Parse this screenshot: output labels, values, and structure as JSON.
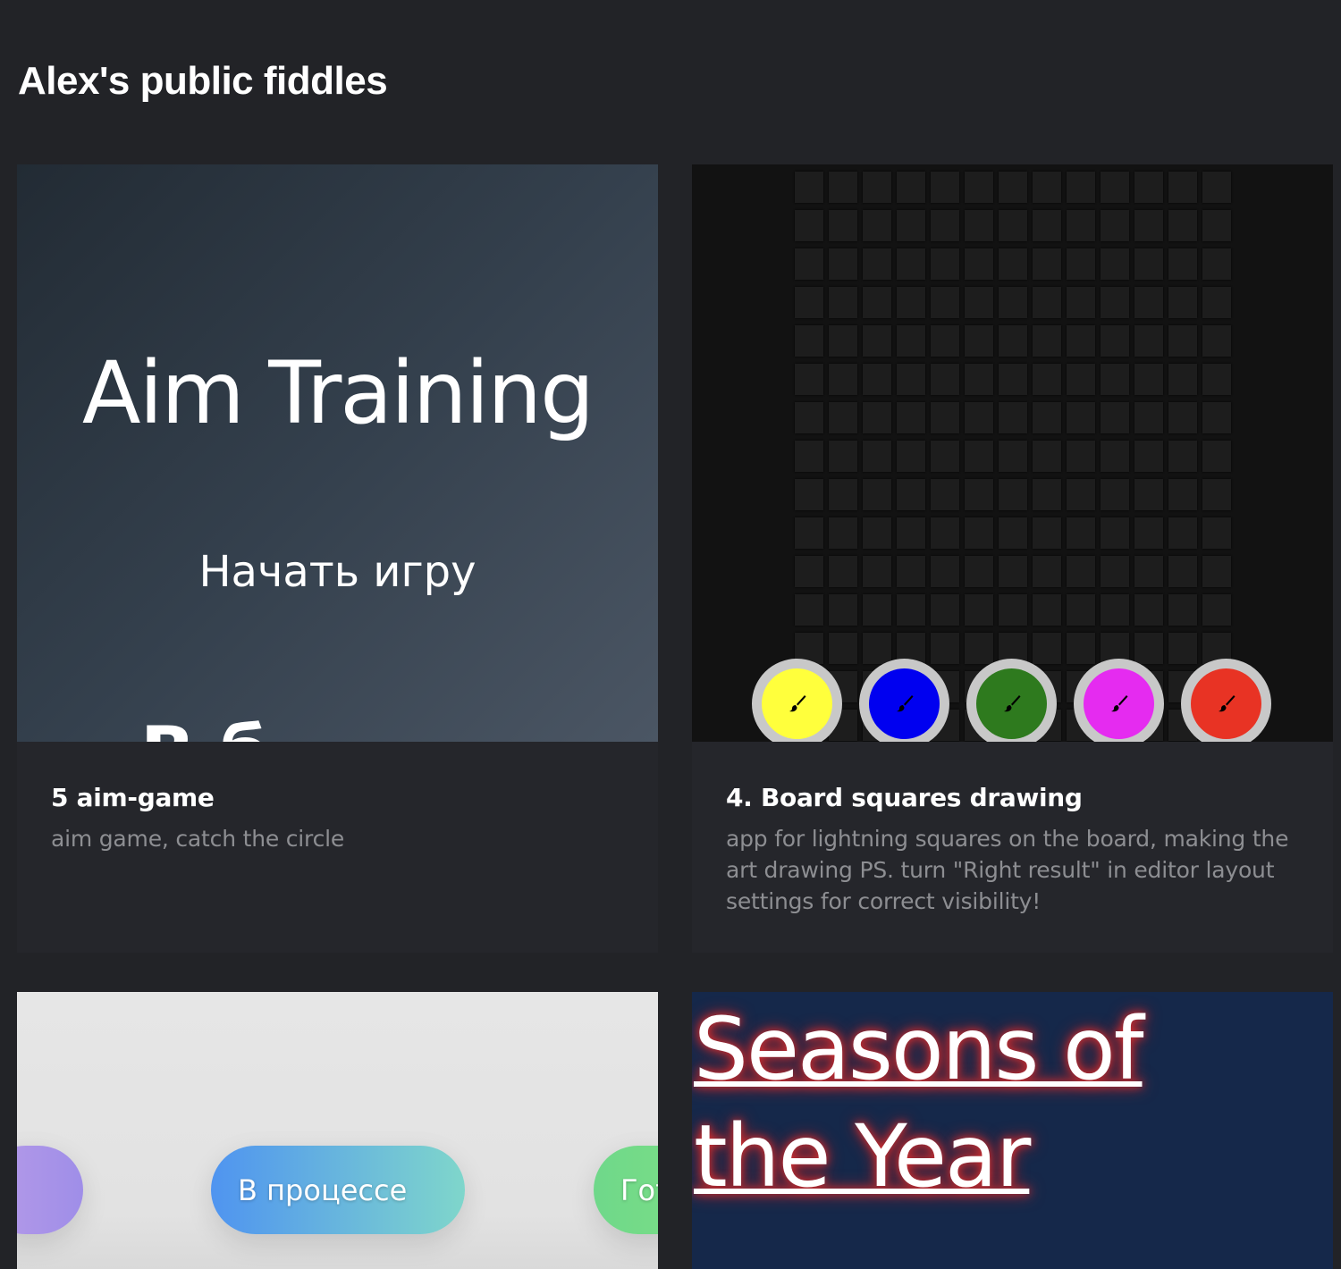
{
  "page": {
    "title": "Alex's public fiddles"
  },
  "cards": [
    {
      "title": "5 aim-game",
      "description": "aim game, catch the circle",
      "preview": {
        "heading": "Aim Training",
        "button": "Начать игру",
        "partial_text": "В   б"
      }
    },
    {
      "title": "4. Board squares drawing",
      "description": "app for lightning squares on the board, making the art drawing PS. turn \"Right result\" in editor layout settings for correct visibility!",
      "preview": {
        "palette": [
          {
            "color": "#ffff3c",
            "icon": "brush-icon"
          },
          {
            "color": "#0000f0",
            "icon": "brush-icon"
          },
          {
            "color": "#2e7a1e",
            "icon": "brush-icon"
          },
          {
            "color": "#e52bf0",
            "icon": "brush-icon"
          },
          {
            "color": "#e83324",
            "icon": "brush-icon"
          }
        ]
      }
    },
    {
      "preview": {
        "pills": [
          "",
          "В процессе",
          "Гот"
        ]
      }
    },
    {
      "preview": {
        "heading": "Seasons of the Year"
      }
    }
  ]
}
